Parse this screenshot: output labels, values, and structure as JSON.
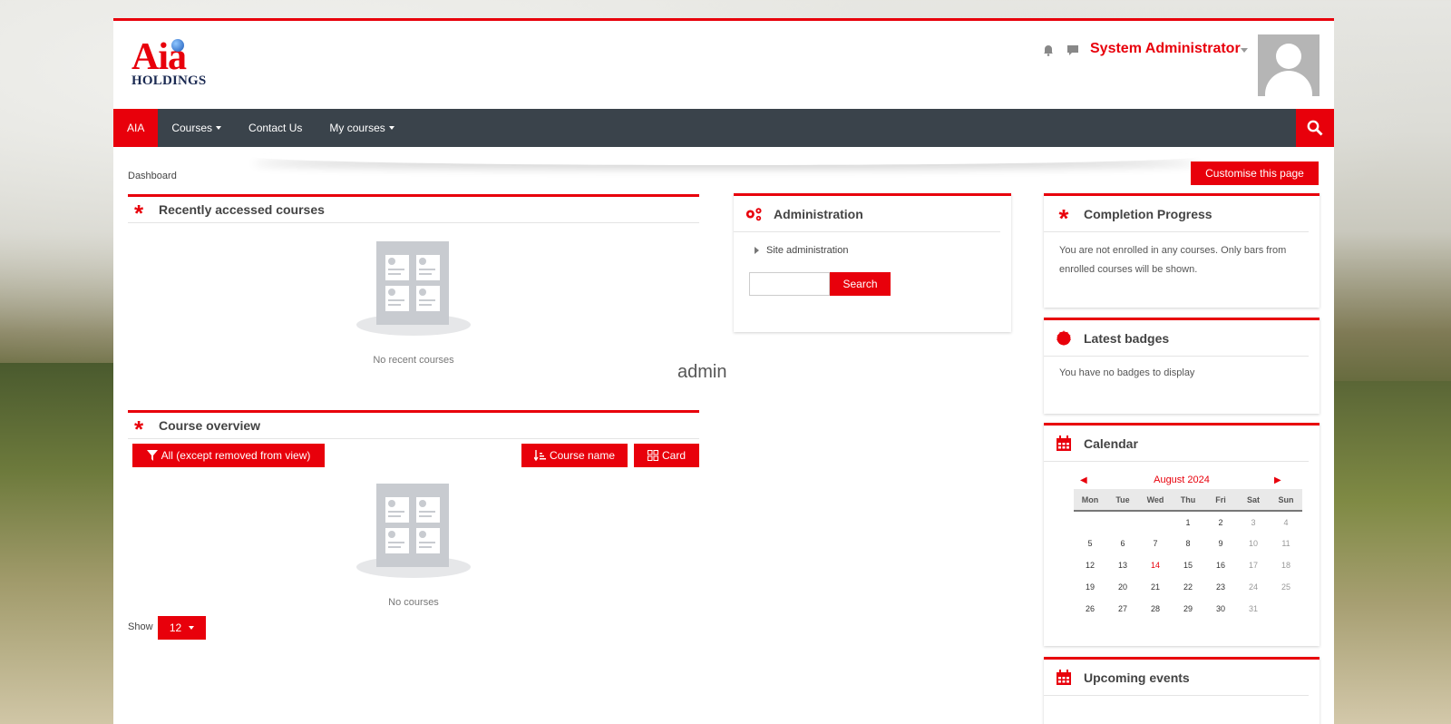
{
  "logo": {
    "main": "Aia",
    "sub": "HOLDINGS"
  },
  "header": {
    "user_name": "System Administrator"
  },
  "nav": {
    "items": [
      {
        "label": "AIA"
      },
      {
        "label": "Courses"
      },
      {
        "label": "Contact Us"
      },
      {
        "label": "My courses"
      }
    ]
  },
  "breadcrumb": "Dashboard",
  "customise_label": "Customise this page",
  "recent": {
    "title": "Recently accessed courses",
    "empty": "No recent courses"
  },
  "overview": {
    "title": "Course overview",
    "filter_label": "All (except removed from view)",
    "sort_label": "Course name",
    "view_label": "Card",
    "empty": "No courses",
    "show_label": "Show",
    "show_value": "12"
  },
  "admin": {
    "title": "Administration",
    "item": "Site administration",
    "search_label": "Search",
    "search_value": ""
  },
  "center_text": "admin",
  "completion": {
    "title": "Completion Progress",
    "text": "You are not enrolled in any courses. Only bars from enrolled courses will be shown."
  },
  "badges": {
    "title": "Latest badges",
    "text": "You have no badges to display"
  },
  "calendar": {
    "title": "Calendar",
    "month": "August 2024",
    "days": [
      "Mon",
      "Tue",
      "Wed",
      "Thu",
      "Fri",
      "Sat",
      "Sun"
    ],
    "weeks": [
      [
        "",
        "",
        "",
        "1",
        "2",
        "3",
        "4"
      ],
      [
        "5",
        "6",
        "7",
        "8",
        "9",
        "10",
        "11"
      ],
      [
        "12",
        "13",
        "14",
        "15",
        "16",
        "17",
        "18"
      ],
      [
        "19",
        "20",
        "21",
        "22",
        "23",
        "24",
        "25"
      ],
      [
        "26",
        "27",
        "28",
        "29",
        "30",
        "31",
        ""
      ]
    ],
    "today": "14"
  },
  "upcoming": {
    "title": "Upcoming events"
  },
  "colors": {
    "accent": "#e8000b",
    "navbar": "#3a434b"
  },
  "icons": {
    "alerts": "bell-icon",
    "messages": "chat-icon",
    "search": "search-icon",
    "asterisk": "asterisk-icon",
    "gears": "gears-icon",
    "badge": "badge-icon",
    "calendar": "calendar-icon"
  }
}
